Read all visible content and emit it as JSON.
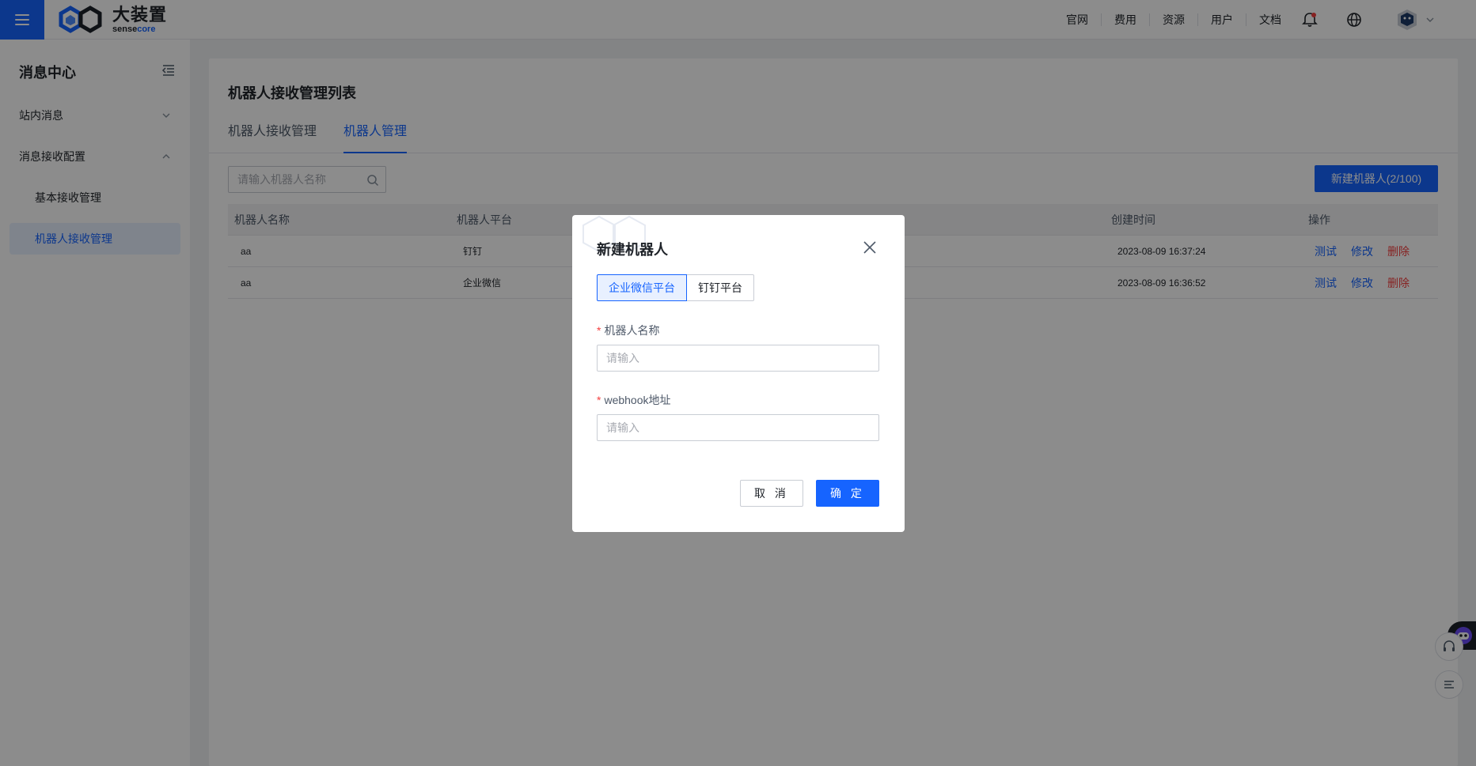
{
  "header": {
    "logo_cn": "大装置",
    "logo_en_1": "sense",
    "logo_en_2": "core",
    "nav": [
      "官网",
      "费用",
      "资源",
      "用户",
      "文档"
    ]
  },
  "sidebar": {
    "title": "消息中心",
    "items": [
      {
        "label": "站内消息"
      },
      {
        "label": "消息接收配置"
      },
      {
        "label": "基本接收管理"
      },
      {
        "label": "机器人接收管理"
      }
    ]
  },
  "page": {
    "title": "机器人接收管理列表",
    "tabs": [
      "机器人接收管理",
      "机器人管理"
    ],
    "search_placeholder": "请输入机器人名称",
    "new_button": "新建机器人(2/100)",
    "table": {
      "columns": [
        "机器人名称",
        "机器人平台",
        "创建时间",
        "操作"
      ],
      "rows": [
        {
          "name": "aa",
          "platform": "钉钉",
          "time": "2023-08-09 16:37:24"
        },
        {
          "name": "aa",
          "platform": "企业微信",
          "time": "2023-08-09 16:36:52"
        }
      ],
      "actions": [
        "测试",
        "修改",
        "删除"
      ]
    }
  },
  "modal": {
    "title": "新建机器人",
    "platforms": [
      "企业微信平台",
      "钉钉平台"
    ],
    "field1_label": "机器人名称",
    "field1_placeholder": "请输入",
    "field2_label": "webhook地址",
    "field2_placeholder": "请输入",
    "required_mark": "*",
    "cancel": "取 消",
    "ok": "确 定"
  },
  "colors": {
    "primary": "#1664ff",
    "danger": "#f53f3f"
  }
}
